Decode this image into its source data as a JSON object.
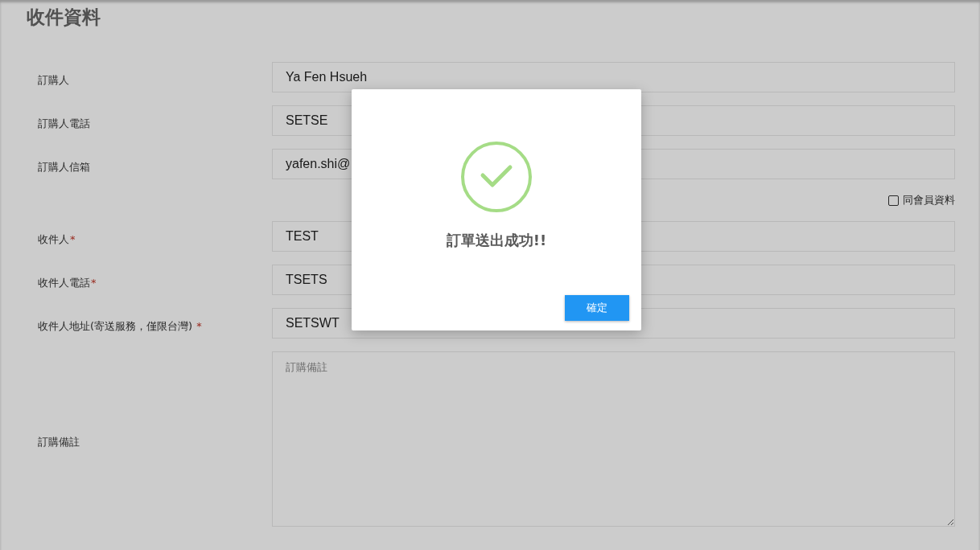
{
  "section_title": "收件資料",
  "buyer_fields": [
    {
      "label": "訂購人",
      "value": "Ya Fen Hsueh"
    },
    {
      "label": "訂購人電話",
      "value": "SETSE"
    },
    {
      "label": "訂購人信箱",
      "value": "yafen.shi@"
    }
  ],
  "same_as_member": {
    "label": "同會員資料",
    "checked": false
  },
  "recipient_fields": [
    {
      "label": "收件人",
      "mark": "*",
      "value": "TEST"
    },
    {
      "label": "收件人電話",
      "mark": "*",
      "value": "TSETS"
    },
    {
      "label": "收件人地址(寄送服務，僅限台灣) ",
      "mark": "*",
      "value": "SETSWT"
    }
  ],
  "notes": {
    "label": "訂購備註",
    "placeholder": "訂購備註"
  },
  "dialog": {
    "message": "訂單送出成功!!",
    "confirm_button": "確定"
  }
}
